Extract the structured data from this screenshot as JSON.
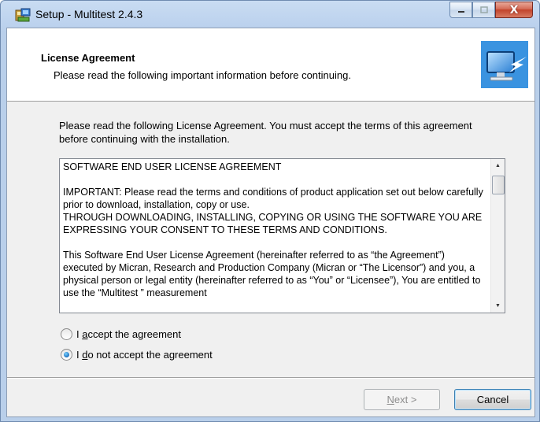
{
  "window": {
    "title": "Setup - Multitest 2.4.3",
    "caption_close": "X"
  },
  "header": {
    "title": "License Agreement",
    "subtitle": "Please read the following important information before continuing."
  },
  "intro": "Please read the following License Agreement. You must accept the terms of this agreement before continuing with the installation.",
  "license_text": "SOFTWARE END USER LICENSE AGREEMENT\n\nIMPORTANT: Please read the terms and conditions of product application set out below carefully prior to download, installation, copy or use.\nTHROUGH DOWNLOADING, INSTALLING, COPYING OR USING THE SOFTWARE YOU ARE EXPRESSING YOUR CONSENT TO THESE TERMS AND CONDITIONS.\n\nThis Software End User License Agreement (hereinafter referred to as “the Agreement”) executed by Micran, Research and Production Company (Micran or “The Licensor”) and you, a physical person or legal entity (hereinafter referred to as “You” or “Licensee”), You are entitled to use the “Multitest ” measurement",
  "options": {
    "accept": {
      "before": "I ",
      "mnemonic": "a",
      "after": "ccept the agreement",
      "checked": false
    },
    "decline": {
      "before": "I ",
      "mnemonic": "d",
      "after": "o not accept the agreement",
      "checked": true
    }
  },
  "buttons": {
    "next": {
      "mnemonic": "N",
      "rest": "ext >",
      "enabled": false
    },
    "cancel": "Cancel"
  }
}
